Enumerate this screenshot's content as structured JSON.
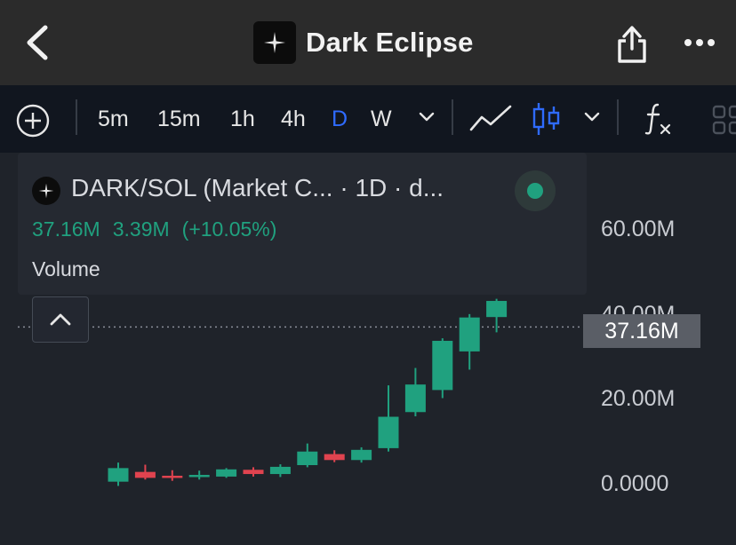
{
  "header": {
    "title": "Dark Eclipse",
    "icons": {
      "back": "chevron-left-icon",
      "share": "share-icon",
      "more": "more-dots-icon",
      "logo": "sparkle-icon"
    }
  },
  "toolbar": {
    "timeframes": [
      "5m",
      "15m",
      "1h",
      "4h",
      "D",
      "W"
    ],
    "active_timeframe": "D",
    "icons": [
      "add-indicator-icon",
      "chevron-down-icon",
      "line-chart-icon",
      "candlestick-icon",
      "chevron-down-icon",
      "function-icon",
      "grid-icon"
    ]
  },
  "legend": {
    "pair": "DARK/SOL (Market C... · 1D · d...",
    "last": "37.16M",
    "change": "3.39M",
    "change_pct": "(+10.05%)",
    "volume_label": "Volume"
  },
  "colors": {
    "up": "#20a17f",
    "down": "#e0434f",
    "accent": "#2f6bff"
  },
  "chart_data": {
    "type": "candlestick",
    "y_ticks": [
      "60.00M",
      "40.00M",
      "20.00M",
      "0.0000"
    ],
    "ylim": [
      0,
      70
    ],
    "last_price_label": "37.16M",
    "last_price": 37.16,
    "candles": [
      {
        "o": 0.7,
        "h": 5.2,
        "l": -0.3,
        "c": 3.9
      },
      {
        "o": 3.0,
        "h": 4.7,
        "l": 1.2,
        "c": 1.6
      },
      {
        "o": 2.1,
        "h": 3.4,
        "l": 0.9,
        "c": 1.8
      },
      {
        "o": 1.9,
        "h": 3.3,
        "l": 1.2,
        "c": 2.3
      },
      {
        "o": 1.9,
        "h": 3.9,
        "l": 1.6,
        "c": 3.6
      },
      {
        "o": 3.5,
        "h": 4.1,
        "l": 1.9,
        "c": 2.5
      },
      {
        "o": 2.5,
        "h": 4.8,
        "l": 1.8,
        "c": 4.2
      },
      {
        "o": 4.6,
        "h": 9.7,
        "l": 4.1,
        "c": 7.8
      },
      {
        "o": 7.2,
        "h": 8.1,
        "l": 5.3,
        "c": 5.8
      },
      {
        "o": 5.8,
        "h": 8.8,
        "l": 5.2,
        "c": 8.2
      },
      {
        "o": 8.6,
        "h": 23.4,
        "l": 7.8,
        "c": 16.0
      },
      {
        "o": 17.1,
        "h": 27.5,
        "l": 16.1,
        "c": 23.6
      },
      {
        "o": 22.3,
        "h": 34.5,
        "l": 20.4,
        "c": 33.9
      },
      {
        "o": 31.4,
        "h": 40.2,
        "l": 27.1,
        "c": 39.4
      },
      {
        "o": 39.5,
        "h": 43.8,
        "l": 35.9,
        "c": 43.3
      }
    ]
  }
}
